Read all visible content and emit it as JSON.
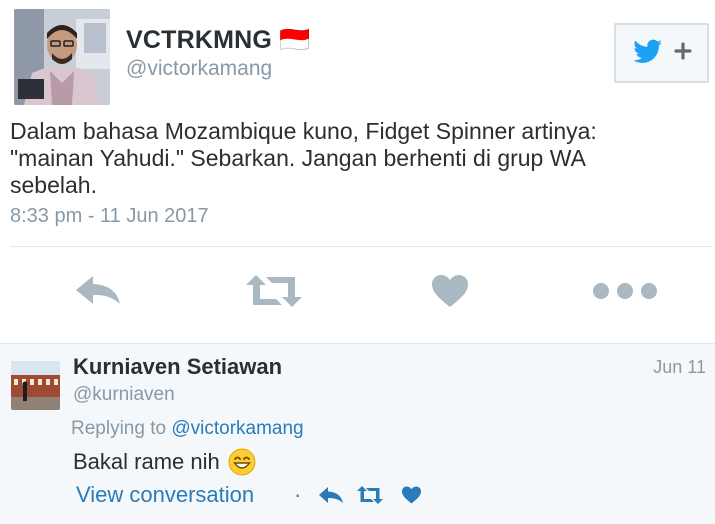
{
  "tweet": {
    "display_name": "VCTRKMNG 🇮🇩",
    "handle": "@victorkamang",
    "text_lines": [
      "Dalam bahasa Mozambique kuno, Fidget Spinner artinya:",
      "\"mainan Yahudi.\" Sebarkan. Jangan berhenti di grup WA",
      "sebelah."
    ],
    "timestamp": "8:33 pm - 11 Jun 2017",
    "follow_icon": "twitter-bird-plus-icon",
    "actions": [
      "reply-icon",
      "retweet-icon",
      "like-icon",
      "more-icon"
    ]
  },
  "reply": {
    "display_name": "Kurniaven Setiawan",
    "handle": "@kurniaven",
    "date": "Jun 11",
    "replying_prefix": "Replying to",
    "replying_to": "@victorkamang",
    "text": "Bakal rame nih",
    "emoji": "grinning-face-emoji",
    "view_conversation": "View conversation",
    "separator": "·"
  },
  "colors": {
    "text": "#292f33",
    "muted": "#8899a6",
    "link": "#2b7bb9",
    "action_gray": "#aab8c2",
    "twitter_blue": "#1da1f2"
  }
}
